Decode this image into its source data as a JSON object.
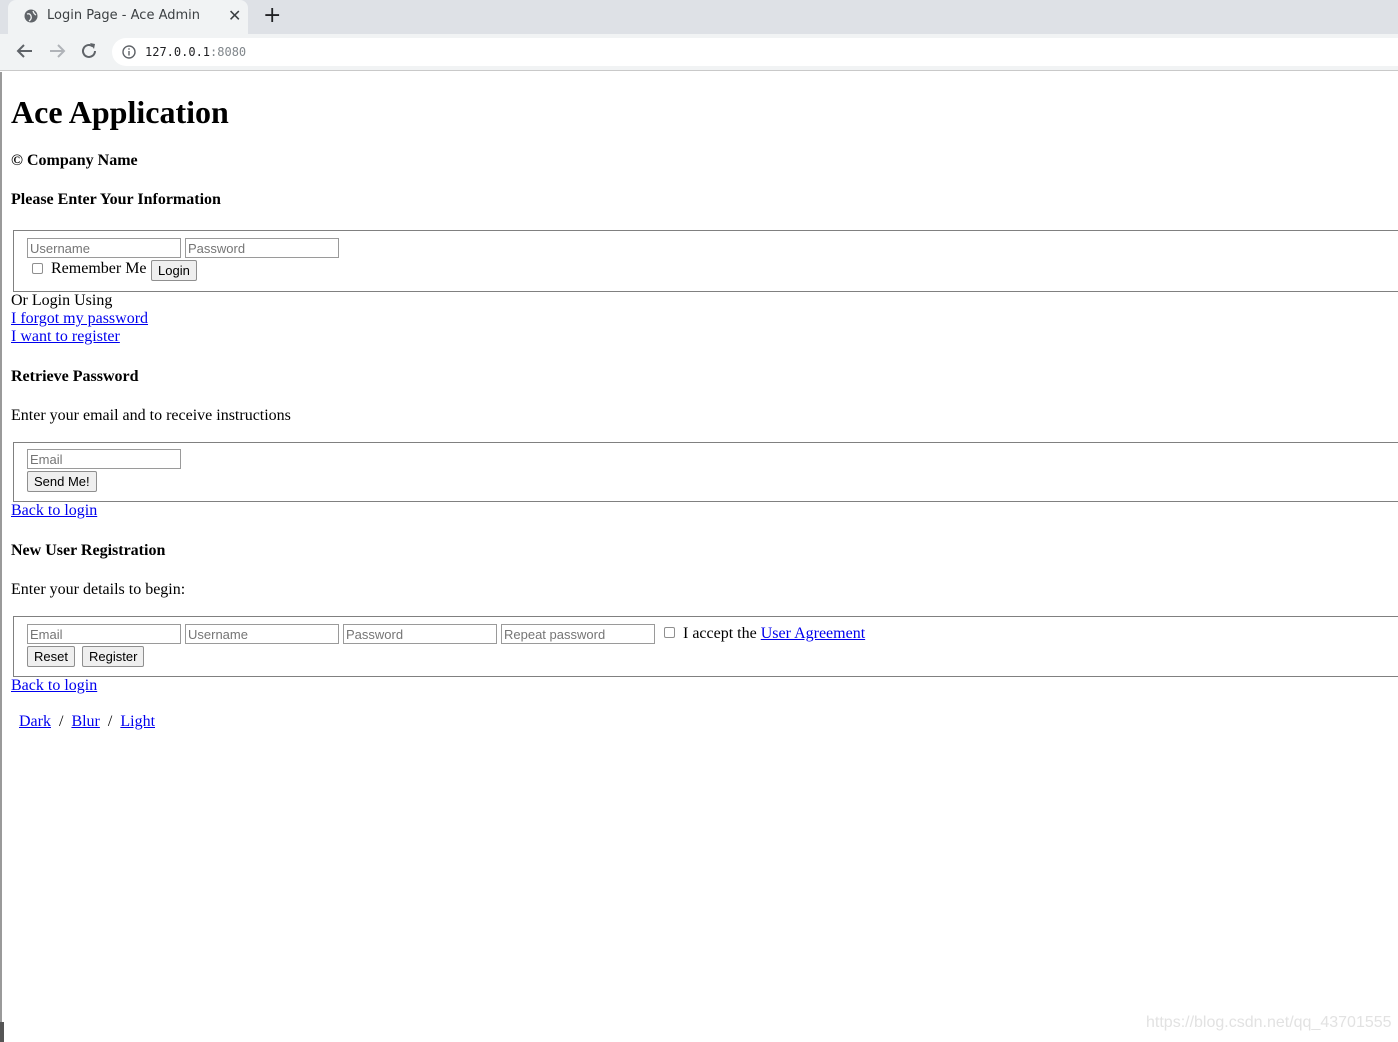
{
  "browser": {
    "tab_title": "Login Page - Ace Admin",
    "url_host": "127.0.0.1",
    "url_port": ":8080"
  },
  "page": {
    "app_title": "Ace Application",
    "company": "© Company Name"
  },
  "login": {
    "heading": "Please Enter Your Information",
    "username_placeholder": "Username",
    "password_placeholder": "Password",
    "remember_label": "Remember Me",
    "login_button": "Login",
    "or_login_using": "Or Login Using",
    "forgot_link": "I forgot my password",
    "register_link": "I want to register"
  },
  "retrieve": {
    "heading": "Retrieve Password",
    "instructions": "Enter your email and to receive instructions",
    "email_placeholder": "Email",
    "send_button": "Send Me!",
    "back_link": "Back to login"
  },
  "registration": {
    "heading": "New User Registration",
    "instructions": "Enter your details to begin:",
    "email_placeholder": "Email",
    "username_placeholder": "Username",
    "password_placeholder": "Password",
    "repeat_password_placeholder": "Repeat password",
    "accept_prefix": "I accept the",
    "agreement_link": "User Agreement",
    "reset_button": "Reset",
    "register_button": "Register",
    "back_link": "Back to login"
  },
  "themes": {
    "dark": "Dark",
    "blur": "Blur",
    "light": "Light",
    "separator": "/"
  },
  "watermark": "https://blog.csdn.net/qq_43701555"
}
